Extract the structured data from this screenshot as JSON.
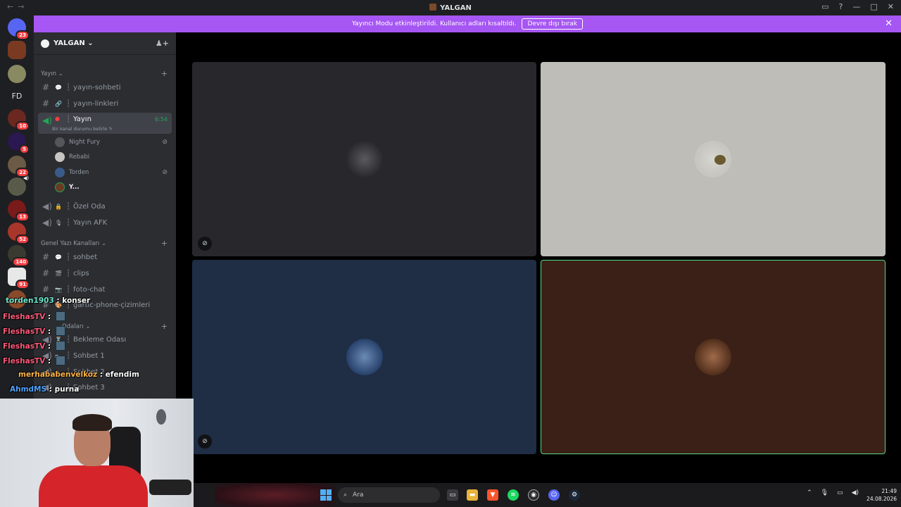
{
  "window": {
    "title": "YALGAN",
    "back_arrow": "←",
    "forward_arrow": "→"
  },
  "banner": {
    "text": "Yayıncı Modu etkinleştirildi. Kullanıcı adları kısaltıldı.",
    "button_label": "Devre dışı bırak",
    "close_symbol": "✕",
    "color": "#a656f3"
  },
  "guilds": [
    {
      "badge": "23"
    },
    {
      "badge": ""
    },
    {
      "badge": ""
    },
    {
      "initials": "FD"
    },
    {
      "badge": "10"
    },
    {
      "badge": "5"
    },
    {
      "badge": "22"
    },
    {
      "badge": ""
    },
    {
      "badge": "13"
    },
    {
      "badge": "52"
    },
    {
      "badge": "140"
    },
    {
      "badge": "91"
    },
    {
      "badge": ""
    }
  ],
  "server": {
    "name": "YALGAN",
    "chevron": "⌄"
  },
  "categories": {
    "yayin": "Yayın",
    "genel_yazi": "Genel Yazı Kanalları",
    "odalari": "Odaları"
  },
  "channels": {
    "yayin_sohbeti": "yayın-sohbeti",
    "yayin_linkleri": "yayın-linkleri",
    "yayin_voice": "Yayın",
    "yayin_timer": "6:54",
    "yayin_status": "Bir kanal durumu belirle",
    "ozel_oda": "Özel Oda",
    "yayin_afk": "Yayın AFK",
    "sohbet": "sohbet",
    "clips": "clips",
    "foto_chat": "foto-chat",
    "gartic": "gartic-phone-çizimleri",
    "bekleme": "Bekleme Odası",
    "sohbet1": "Sohbet 1",
    "sohbet2": "Sohbet 2",
    "sohbet3": "Sohbet 3"
  },
  "voice_users": [
    {
      "name": "Night Fury",
      "muted": true
    },
    {
      "name": "Rebabi",
      "muted": false
    },
    {
      "name": "Torden",
      "muted": true
    },
    {
      "name": "Y...",
      "muted": false
    }
  ],
  "tiles": [
    {
      "bg": "#28272c",
      "muted": true
    },
    {
      "bg": "#bebdb8",
      "muted": false
    },
    {
      "bg": "#1f2d45",
      "muted": true
    },
    {
      "bg": "#3a2016",
      "muted": false,
      "speaking": true
    }
  ],
  "chat_overlay": [
    {
      "user": "torden1903",
      "sep": " : ",
      "msg": "konser",
      "color": "#6ee8d0"
    },
    {
      "user": "FleshasTV",
      "sep": " : ",
      "msg": "",
      "color": "#ff5a7a"
    },
    {
      "user": "FleshasTV",
      "sep": " : ",
      "msg": "",
      "color": "#ff5a7a"
    },
    {
      "user": "FleshasTV",
      "sep": " : ",
      "msg": "",
      "color": "#ff5a7a"
    },
    {
      "user": "FleshasTV",
      "sep": " : ",
      "msg": "",
      "color": "#ff5a7a"
    },
    {
      "user": "merhababenvelkoz",
      "sep": " : ",
      "msg": "efendim",
      "color": "#ffb347"
    },
    {
      "user": "AhmdMS",
      "sep": " : ",
      "msg": "purna",
      "color": "#4fa3ff"
    }
  ],
  "taskbar": {
    "search_placeholder": "Ara",
    "time": "21:49",
    "date": "24.08.2026",
    "apps": [
      "file-explorer",
      "brave",
      "spotify",
      "obs",
      "discord",
      "steam"
    ]
  }
}
